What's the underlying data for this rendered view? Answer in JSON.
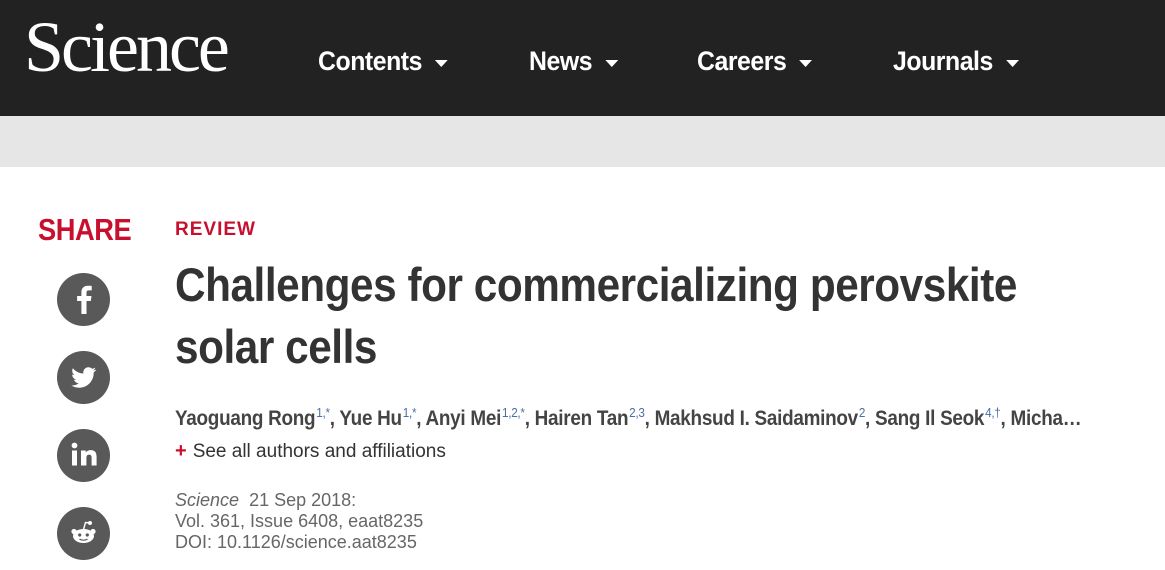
{
  "header": {
    "logo": "Science",
    "nav": [
      {
        "label": "Contents"
      },
      {
        "label": "News"
      },
      {
        "label": "Careers"
      },
      {
        "label": "Journals"
      }
    ]
  },
  "share": {
    "title": "SHARE",
    "buttons": [
      {
        "icon": "facebook-icon"
      },
      {
        "icon": "twitter-icon"
      },
      {
        "icon": "linkedin-icon"
      },
      {
        "icon": "reddit-icon"
      }
    ]
  },
  "article": {
    "type": "REVIEW",
    "title_line1": "Challenges for commercializing perovskite",
    "title_line2": "solar cells",
    "authors": [
      {
        "name": "Yaoguang Rong",
        "sup": "1,*"
      },
      {
        "name": "Yue Hu",
        "sup": "1,*"
      },
      {
        "name": "Anyi Mei",
        "sup": "1,2,*"
      },
      {
        "name": "Hairen Tan",
        "sup": "2,3"
      },
      {
        "name": "Makhsud I. Saidaminov",
        "sup": "2"
      },
      {
        "name": "Sang Il Seok",
        "sup": "4,†"
      },
      {
        "name": "Micha…",
        "sup": ""
      }
    ],
    "see_all": "See all authors and affiliations",
    "journal": "Science",
    "date": "21 Sep 2018:",
    "volume": "Vol. 361, Issue 6408, eaat8235",
    "doi": "DOI: 10.1126/science.aat8235"
  }
}
